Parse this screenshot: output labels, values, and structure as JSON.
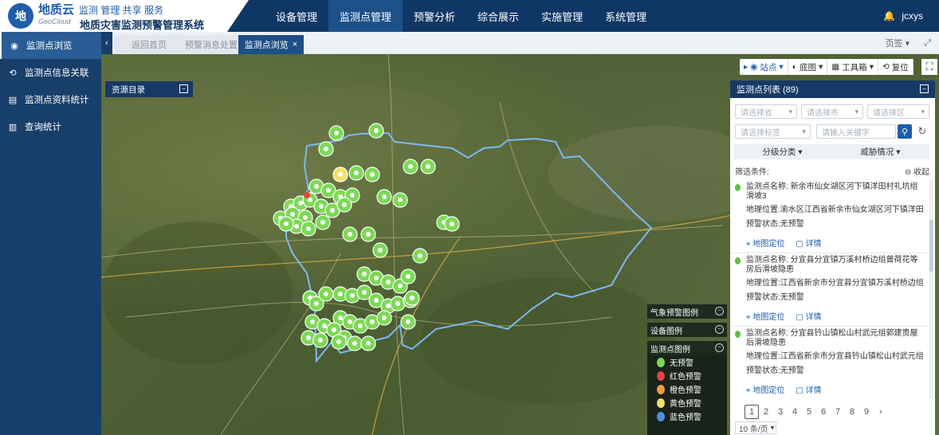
{
  "brand": {
    "name": "地质云",
    "slogan": "监测 管理 共享 服务",
    "sub": "GeoCloud",
    "system": "地质灾害监测预警管理系统"
  },
  "nav": [
    "设备管理",
    "监测点管理",
    "预警分析",
    "综合展示",
    "实施管理",
    "系统管理"
  ],
  "user": {
    "name": "jcxys",
    "icon": "bell-icon"
  },
  "sidebar": [
    {
      "label": "监测点浏览",
      "icon": "eye-icon"
    },
    {
      "label": "监测点信息关联",
      "icon": "link-icon"
    },
    {
      "label": "监测点资料统计",
      "icon": "document-icon"
    },
    {
      "label": "查询统计",
      "icon": "chart-icon"
    }
  ],
  "tabs": [
    "返回首页",
    "预警消息处置",
    "监测点浏览"
  ],
  "tab_close": "×",
  "tab_right": {
    "page": "页签",
    "expand": "⤢"
  },
  "map_tools": [
    "站点",
    "底图",
    "工具箱",
    "复位"
  ],
  "resource_panel": "资源目录",
  "legends": {
    "weather": "气象预警图例",
    "device": "设备图例",
    "point": "监测点图例",
    "items": [
      {
        "label": "无预警",
        "color": "#7ed957"
      },
      {
        "label": "红色预警",
        "color": "#e04545"
      },
      {
        "label": "橙色预警",
        "color": "#f0a040"
      },
      {
        "label": "黄色预警",
        "color": "#f3e06b"
      },
      {
        "label": "蓝色预警",
        "color": "#4d8fe0"
      }
    ]
  },
  "list_panel": {
    "title": "监测点列表 (89)",
    "selects": [
      "请选择省",
      "请选择市",
      "请选择区",
      "请选择标签"
    ],
    "keyword_placeholder": "请输入关键字",
    "filters": [
      "分级分类",
      "威胁情况"
    ],
    "condition_label": "筛选条件:",
    "collapse_label": "收起",
    "items": [
      {
        "name_label": "监测点名称:",
        "name": "新余市仙女湖区河下镇洋田村礼坑组滑坡3",
        "location_label": "地理位置:",
        "location": "渝水区江西省新余市仙女湖区河下镇洋田",
        "status_label": "预警状态:",
        "status": "无预警",
        "locate": "地图定位",
        "detail": "详情"
      },
      {
        "name_label": "监测点名称:",
        "name": "分宜县分宜镇万溪村桥边组曾荷花等房后滑坡隐患",
        "location_label": "地理位置:",
        "location": "江西省新余市分宜县分宜镇万溪村桥边组",
        "status_label": "预警状态:",
        "status": "无预警",
        "locate": "地图定位",
        "detail": "详情"
      },
      {
        "name_label": "监测点名称:",
        "name": "分宜县钤山镇松山村武元组郭建贵屋后滑坡隐患",
        "location_label": "地理位置:",
        "location": "江西省新余市分宜县钤山镇松山村武元组",
        "status_label": "预警状态:",
        "status": "无预警",
        "locate": "地图定位",
        "detail": "详情"
      }
    ],
    "pages": [
      "1",
      "2",
      "3",
      "4",
      "5",
      "6",
      "7",
      "8",
      "9"
    ],
    "current_page": "1",
    "page_size": "10 条/页"
  },
  "colors": {
    "header": "#0f3766",
    "sidebar": "#183e6a",
    "accent": "#1d5ea8",
    "pin": "#7ed957"
  }
}
